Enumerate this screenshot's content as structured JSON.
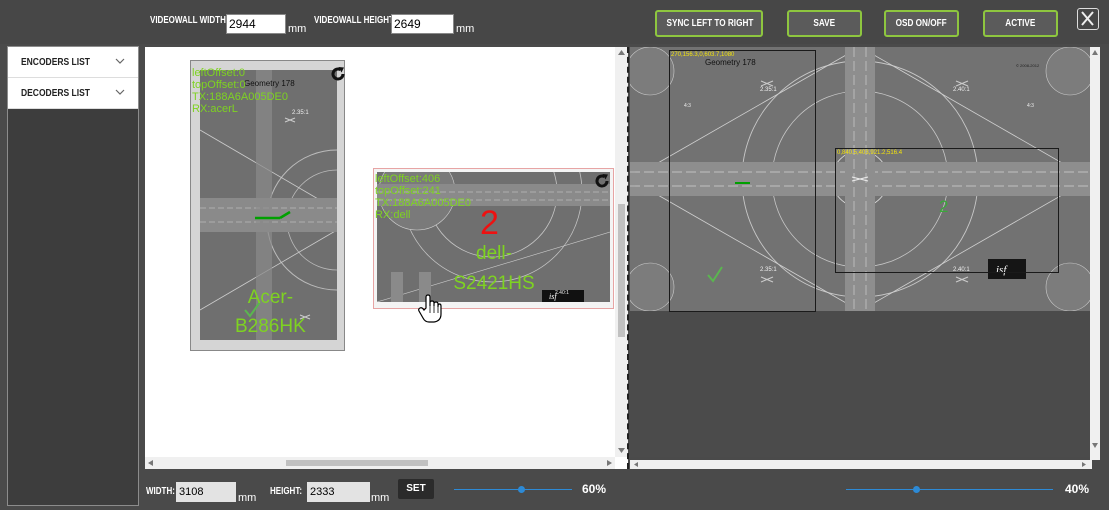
{
  "toolbar": {
    "videowall_width_label": "VIDEOWALL WIDTH:",
    "videowall_width_value": "2944",
    "videowall_width_unit": "mm",
    "videowall_height_label": "VIDEOWALL HEIGHT:",
    "videowall_height_value": "2649",
    "videowall_height_unit": "mm",
    "sync_label": "SYNC LEFT TO RIGHT",
    "save_label": "SAVE",
    "osd_label": "OSD ON/OFF",
    "active_label": "ACTIVE",
    "accent_color": "#8ec63f"
  },
  "sidebar": {
    "items": [
      {
        "label": "ENCODERS LIST",
        "icon": "chevron-down-icon"
      },
      {
        "label": "DECODERS LIST",
        "icon": "chevron-down-icon"
      }
    ]
  },
  "left_canvas": {
    "displays": [
      {
        "lines": [
          "leftOffset:0",
          "topOffset:0",
          "TX:188A6A005DE0",
          "RX:acerL"
        ],
        "model": [
          "Acer-",
          "B286HK"
        ],
        "chart_title": "Geometry 178",
        "ratio": "2.35:1"
      },
      {
        "lines": [
          "leftOffset:406",
          "topOffset:241",
          "TX:188A6A005DE0",
          "RX:dell"
        ],
        "number": "2",
        "model": [
          "dell-",
          "S2421HS"
        ],
        "ratio": "2.40:1"
      }
    ]
  },
  "right_canvas": {
    "chart_title": "Geometry 178",
    "copyright": "© 2008-2012",
    "ratios": [
      "2.35:1",
      "2.40:1",
      "2.35:1",
      "2.40:1"
    ],
    "aspect_marks": [
      "4:3",
      "4:3"
    ],
    "regions": [
      {
        "label": "270,156.3,0,603.7,1080"
      },
      {
        "label": "0,840.5,403,921.2,516.4",
        "number": "2"
      }
    ]
  },
  "bottom": {
    "width_label": "WIDTH:",
    "width_value": "3108",
    "width_unit": "mm",
    "height_label": "HEIGHT:",
    "height_value": "2333",
    "height_unit": "mm",
    "set_label": "SET",
    "left_zoom": "60%",
    "right_zoom": "40%"
  }
}
